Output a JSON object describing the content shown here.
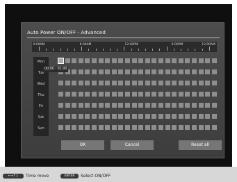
{
  "dialog": {
    "title": "Auto Power ON/OFF - Advanced",
    "time_labels": [
      "0:00AM",
      "6:00AM",
      "12:00PM",
      "6:00PM",
      "12:00AM"
    ],
    "days": [
      "Mon",
      "Tue",
      "Wed",
      "Thu",
      "Fri",
      "Sat",
      "Sun"
    ],
    "tooltip": "00:00 - 01:00",
    "hours_per_day": 24,
    "selected": {
      "day": "Mon",
      "hour": "00:00 - 01:00"
    },
    "buttons": {
      "ok": "OK",
      "cancel": "Cancel",
      "reset_all": "Reset all"
    }
  },
  "statusbar": {
    "arrows_icon": "arrow-keys-icon",
    "time_move": "Time move",
    "enter_key": "ENTER",
    "select": "Select ON/OFF"
  }
}
